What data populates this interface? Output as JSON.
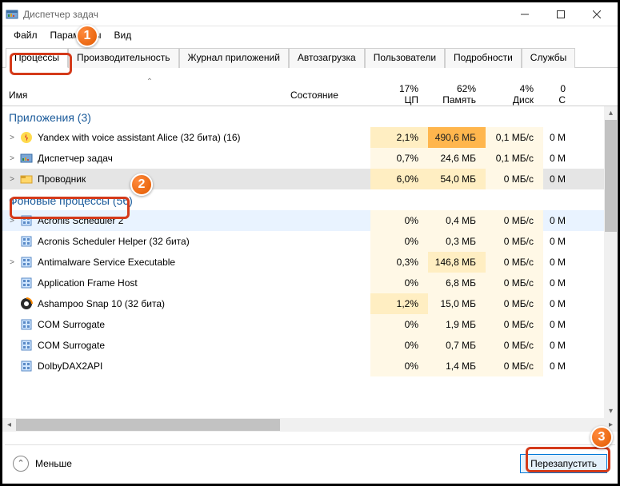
{
  "window": {
    "title": "Диспетчер задач",
    "menu": [
      "Файл",
      "Параметры",
      "Вид"
    ]
  },
  "tabs": [
    "Процессы",
    "Производительность",
    "Журнал приложений",
    "Автозагрузка",
    "Пользователи",
    "Подробности",
    "Службы"
  ],
  "columns": {
    "name": "Имя",
    "status": "Состояние",
    "cpu_label": "ЦП",
    "mem_label": "Память",
    "disk_label": "Диск",
    "net_label": "С",
    "cpu_pct": "17%",
    "mem_pct": "62%",
    "disk_pct": "4%",
    "net_pct": "0"
  },
  "groups": {
    "apps": "Приложения (3)",
    "bg": "Фоновые процессы (56)"
  },
  "apps": [
    {
      "name": "Yandex with voice assistant Alice (32 бита) (16)",
      "cpu": "2,1%",
      "mem": "490,6 МБ",
      "disk": "0,1 МБ/с",
      "net": "0 М",
      "expand": true,
      "icon": "yandex"
    },
    {
      "name": "Диспетчер задач",
      "cpu": "0,7%",
      "mem": "24,6 МБ",
      "disk": "0,1 МБ/с",
      "net": "0 М",
      "expand": true,
      "icon": "tm"
    },
    {
      "name": "Проводник",
      "cpu": "6,0%",
      "mem": "54,0 МБ",
      "disk": "0 МБ/с",
      "net": "0 М",
      "expand": true,
      "icon": "explorer",
      "selected": true
    }
  ],
  "bg": [
    {
      "name": "Acronis Scheduler 2",
      "cpu": "0%",
      "mem": "0,4 МБ",
      "disk": "0 МБ/с",
      "net": "0 М",
      "expand": true,
      "icon": "win",
      "hover": true
    },
    {
      "name": "Acronis Scheduler Helper (32 бита)",
      "cpu": "0%",
      "mem": "0,3 МБ",
      "disk": "0 МБ/с",
      "net": "0 М",
      "icon": "win"
    },
    {
      "name": "Antimalware Service Executable",
      "cpu": "0,3%",
      "mem": "146,8 МБ",
      "disk": "0 МБ/с",
      "net": "0 М",
      "expand": true,
      "icon": "win"
    },
    {
      "name": "Application Frame Host",
      "cpu": "0%",
      "mem": "6,8 МБ",
      "disk": "0 МБ/с",
      "net": "0 М",
      "icon": "win"
    },
    {
      "name": "Ashampoo Snap 10 (32 бита)",
      "cpu": "1,2%",
      "mem": "15,0 МБ",
      "disk": "0 МБ/с",
      "net": "0 М",
      "icon": "snap"
    },
    {
      "name": "COM Surrogate",
      "cpu": "0%",
      "mem": "1,9 МБ",
      "disk": "0 МБ/с",
      "net": "0 М",
      "icon": "win"
    },
    {
      "name": "COM Surrogate",
      "cpu": "0%",
      "mem": "0,7 МБ",
      "disk": "0 МБ/с",
      "net": "0 М",
      "icon": "win"
    },
    {
      "name": "DolbyDAX2API",
      "cpu": "0%",
      "mem": "1,4 МБ",
      "disk": "0 МБ/с",
      "net": "0 М",
      "icon": "win"
    }
  ],
  "footer": {
    "fewer": "Меньше",
    "restart": "Перезапустить"
  },
  "callouts": {
    "c1": "1",
    "c2": "2",
    "c3": "3"
  }
}
